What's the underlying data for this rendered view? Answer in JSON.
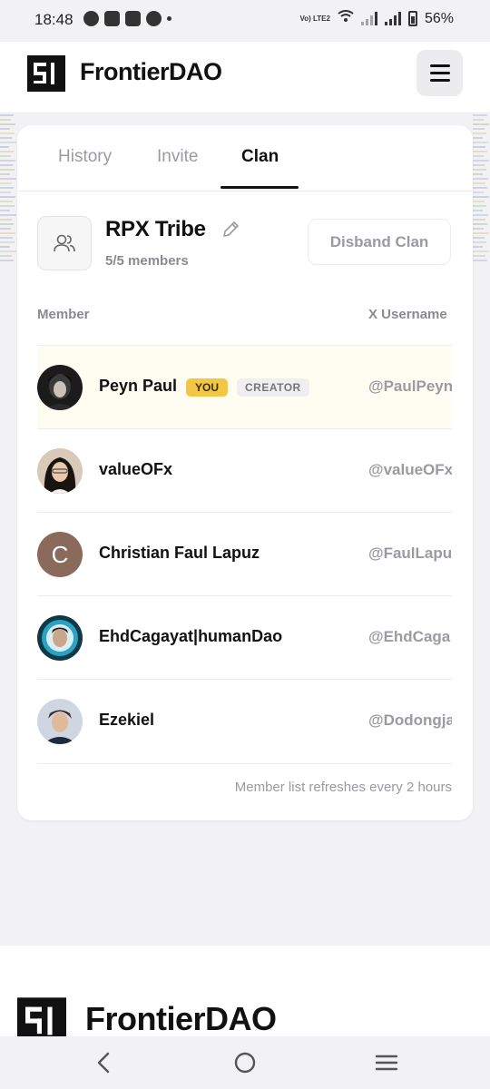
{
  "status_bar": {
    "time": "18:48",
    "network_label": "Vo) LTE2",
    "battery": "56%"
  },
  "header": {
    "brand": "FrontierDAO",
    "menu_icon": "hamburger-menu-icon"
  },
  "tabs": [
    {
      "label": "History",
      "active": false
    },
    {
      "label": "Invite",
      "active": false
    },
    {
      "label": "Clan",
      "active": true
    }
  ],
  "clan": {
    "name": "RPX Tribe",
    "members_count": "5/5 members",
    "disband_label": "Disband Clan",
    "icon": "users-icon",
    "edit_icon": "pencil-icon"
  },
  "table": {
    "col_member": "Member",
    "col_x_username": "X Username",
    "rows": [
      {
        "name": "Peyn Paul",
        "badge_you": "YOU",
        "badge_creator": "CREATOR",
        "x": "@PaulPeyn"
      },
      {
        "name": "valueOFx",
        "x": "@valueOFx"
      },
      {
        "name": "Christian Faul Lapuz",
        "avatar_letter": "C",
        "x": "@FaulLapu"
      },
      {
        "name": "EhdCagayat|humanDao",
        "x": "@EhdCaga"
      },
      {
        "name": "Ezekiel",
        "x": "@Dodongja"
      }
    ],
    "refresh_note": "Member list refreshes every 2 hours"
  },
  "footer": {
    "brand": "FrontierDAO"
  },
  "colors": {
    "accent_badge": "#f2c744",
    "highlight_row": "#fffcf2",
    "background": "#f2f2f4"
  }
}
